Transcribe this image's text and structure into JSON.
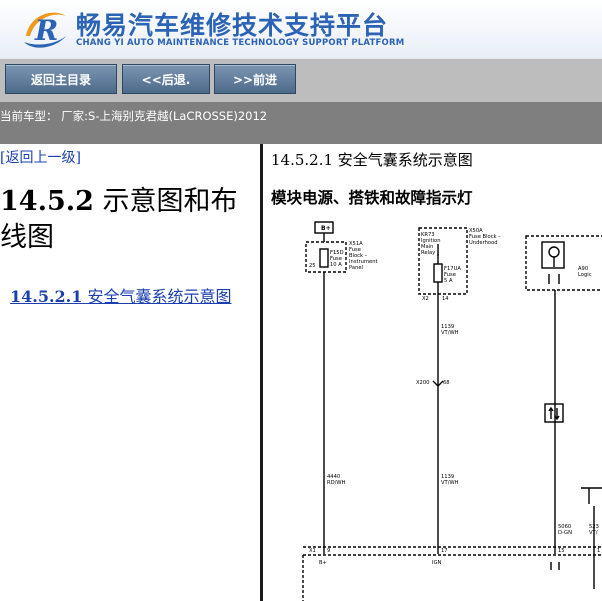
{
  "header": {
    "brand_cn": "畅易汽车维修技术支持平台",
    "brand_en": "CHANG YI AUTO MAINTENANCE TECHNOLOGY SUPPORT PLATFORM",
    "logo_letter": "R",
    "colors": {
      "brand_blue": "#2b63b5",
      "logo_orange": "#f39a1e"
    }
  },
  "nav": {
    "home_label": "返回主目录",
    "back_label": "<<后退.",
    "forward_label": ">>前进"
  },
  "info": {
    "vehicle_text": "当前车型： 厂家:S-上海别克君越(LaCROSSE)2012"
  },
  "left": {
    "back_up_label": "[返回上一级]",
    "section_number": "14.5.2",
    "section_title": " 示意图和布线图",
    "sub_link_number": "14.5.2.1",
    "sub_link_title": " 安全气囊系统示意图"
  },
  "right": {
    "title": "14.5.2.1 安全气囊系统示意图",
    "subtitle": "模块电源、搭铁和故障指示灯"
  },
  "diagram": {
    "bplus_box": "B+",
    "x51a_label": [
      "X51A",
      "Fuse",
      "Block –",
      "Instrument",
      "Panel"
    ],
    "f15d_label": [
      "F15D",
      "Fuse",
      "10 A"
    ],
    "pin_25": "25",
    "x50a_label": [
      "X50A",
      "Fuse Block –",
      "Underhood"
    ],
    "kr73_label": [
      "KR73",
      "Ignition",
      "Main",
      "Relay"
    ],
    "f17ua_label": [
      "F17UA",
      "Fuse",
      "5 A"
    ],
    "x2_label": "X2",
    "pin_14": "14",
    "wire_1139_a": [
      "1139",
      "VT/WH"
    ],
    "x200_label": "X200",
    "pin_68": "68",
    "wire_1139_b": [
      "1139",
      "VT/WH"
    ],
    "wire_4440": [
      "4440",
      "RD/WH"
    ],
    "a90_label": [
      "A90",
      "Logic"
    ],
    "wire_5060": [
      "5060",
      "D-GN"
    ],
    "wire_523_partial": [
      "523",
      "VT/"
    ],
    "x1_label": "X1",
    "pin_9": "9",
    "pin_17": "17",
    "pin_15": "15",
    "pin_16_partial": "1",
    "bplus_bottom": "B+",
    "ign_bottom": "IGN"
  }
}
